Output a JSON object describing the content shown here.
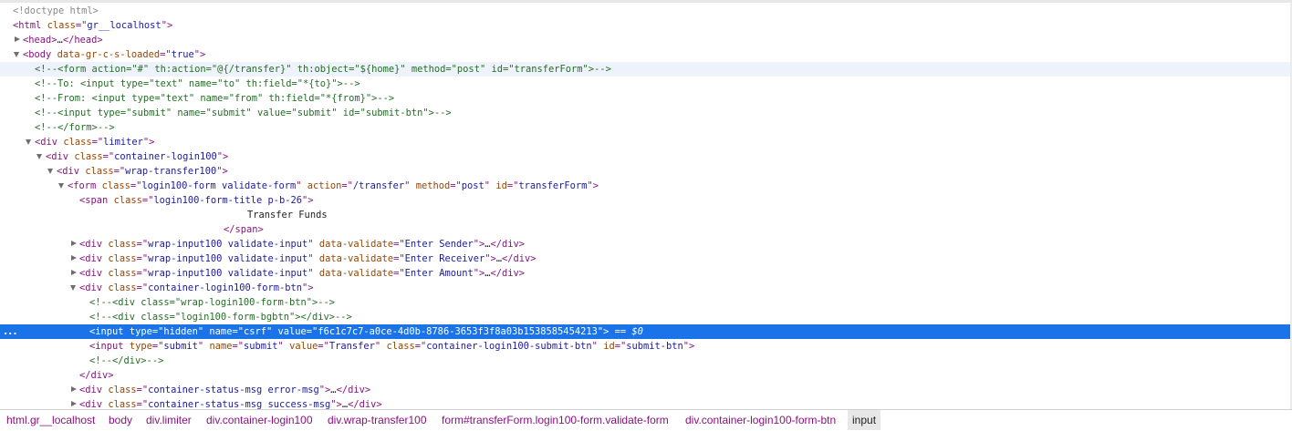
{
  "dom_tree": {
    "doctype": "<!doctype html>",
    "html_open": {
      "tag": "html",
      "attr_name": "class",
      "attr_value": "gr__localhost"
    },
    "head": {
      "open": "<head>",
      "ellipsis": "…",
      "close": "</head>"
    },
    "body_open": {
      "tag": "body",
      "attr_name": "data-gr-c-s-loaded",
      "attr_value": "true"
    },
    "comments": [
      "<!--<form action=\"#\" th:action=\"@{/transfer}\" th:object=\"${home}\" method=\"post\" id=\"transferForm\">-->",
      "<!--To: <input type=\"text\" name=\"to\" th:field=\"*{to}\">-->",
      "<!--From: <input type=\"text\" name=\"from\" th:field=\"*{from}\">-->",
      "<!--<input type=\"submit\" name=\"submit\" value=\"submit\" id=\"submit-btn\">-->",
      "<!--</form>-->"
    ],
    "limiter": {
      "tag": "div",
      "attr_name": "class",
      "attr_value": "limiter"
    },
    "container_login": {
      "tag": "div",
      "attr_name": "class",
      "attr_value": "container-login100"
    },
    "wrap_transfer": {
      "tag": "div",
      "attr_name": "class",
      "attr_value": "wrap-transfer100"
    },
    "form": {
      "tag": "form",
      "class_name": "class",
      "class_value": "login100-form validate-form",
      "action_name": "action",
      "action_value": "/transfer",
      "method_name": "method",
      "method_value": "post",
      "id_name": "id",
      "id_value": "transferForm"
    },
    "span": {
      "tag": "span",
      "attr_name": "class",
      "attr_value": "login100-form-title p-b-26",
      "text": "Transfer Funds",
      "close": "</span>"
    },
    "inputs": [
      {
        "tag": "div",
        "class_value": "wrap-input100 validate-input",
        "dv_name": "data-validate",
        "dv_value": "Enter Sender"
      },
      {
        "tag": "div",
        "class_value": "wrap-input100 validate-input",
        "dv_name": "data-validate",
        "dv_value": "Enter Receiver"
      },
      {
        "tag": "div",
        "class_value": "wrap-input100 validate-input",
        "dv_name": "data-validate",
        "dv_value": "Enter Amount"
      }
    ],
    "btn_container": {
      "tag": "div",
      "attr_name": "class",
      "attr_value": "container-login100-form-btn"
    },
    "btn_comments": [
      "<!--<div class=\"wrap-login100-form-btn\">-->",
      "<!--<div class=\"login100-form-bgbtn\"></div>-->"
    ],
    "hidden_input": {
      "tag": "input",
      "type_name": "type",
      "type_value": "hidden",
      "name_name": "name",
      "name_value": "csrf",
      "value_name": "value",
      "value_value": "f6c1c7c7-a0ce-4d0b-8786-3653f3f8a03b1538585454213",
      "suffix": "== $0",
      "dots": "..."
    },
    "submit_input": {
      "tag": "input",
      "type_name": "type",
      "type_value": "submit",
      "name_name": "name",
      "name_value": "submit",
      "value_name": "value",
      "value_value": "Transfer",
      "class_name": "class",
      "class_value": "container-login100-submit-btn",
      "id_name": "id",
      "id_value": "submit-btn"
    },
    "close_comment": "<!--</div>-->",
    "div_close": "</div>",
    "status_msgs": [
      {
        "tag": "div",
        "attr_name": "class",
        "attr_value": "container-status-msg error-msg"
      },
      {
        "tag": "div",
        "attr_name": "class",
        "attr_value": "container-status-msg success-msg"
      }
    ],
    "ellipsis": "…"
  },
  "breadcrumb": [
    "html.gr__localhost",
    "body",
    "div.limiter",
    "div.container-login100",
    "div.wrap-transfer100",
    "form#transferForm.login100-form.validate-form",
    "div.container-login100-form-btn",
    "input"
  ],
  "colors": {
    "tag": "#881280",
    "attr_name": "#994500",
    "attr_value": "#1a1aa6",
    "comment": "#236e25",
    "selection": "#1a73e8",
    "hover": "#eef3fb"
  }
}
